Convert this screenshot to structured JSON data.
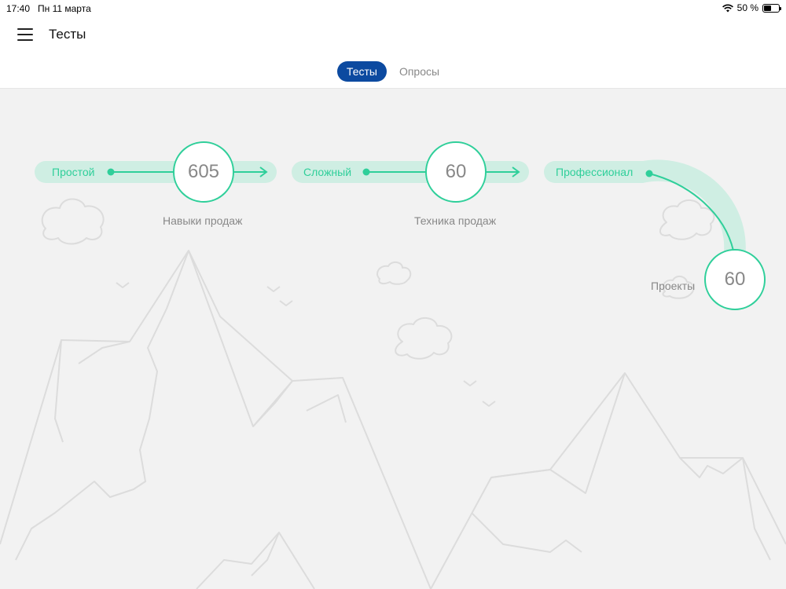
{
  "status": {
    "time": "17:40",
    "date": "Пн 11 марта",
    "battery": "50 %",
    "battery_level": 0.5
  },
  "header": {
    "title": "Тесты",
    "menu_icon": "hamburger-icon"
  },
  "tabs": [
    {
      "label": "Тесты",
      "active": true
    },
    {
      "label": "Опросы",
      "active": false
    }
  ],
  "tracks": [
    {
      "level": "Простой",
      "value": "605",
      "category": "Навыки продаж"
    },
    {
      "level": "Сложный",
      "value": "60",
      "category": "Техника продаж"
    },
    {
      "level": "Профессионал",
      "value": "60",
      "category": "Проекты"
    }
  ],
  "colors": {
    "accent": "#2fcf9a",
    "track_bg": "#cfeee3",
    "tab_active": "#0c4aa0",
    "line_art": "#dcdcdc"
  }
}
